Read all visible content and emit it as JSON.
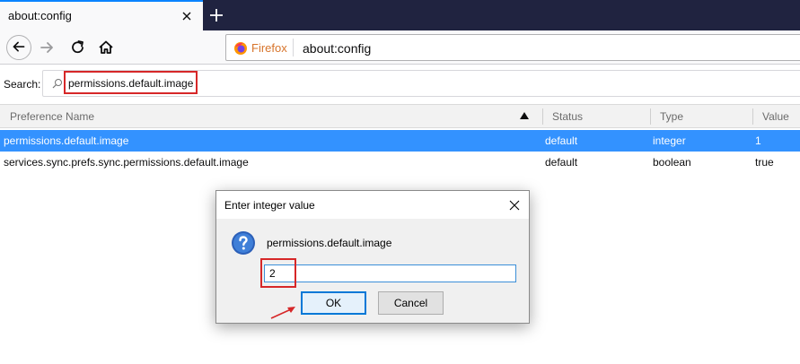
{
  "tab": {
    "title": "about:config"
  },
  "urlbar": {
    "identity_label": "Firefox",
    "url": "about:config"
  },
  "search": {
    "label": "Search:",
    "value": "permissions.default.image"
  },
  "table": {
    "headers": {
      "name": "Preference Name",
      "status": "Status",
      "type": "Type",
      "value": "Value"
    },
    "rows": [
      {
        "name": "permissions.default.image",
        "status": "default",
        "type": "integer",
        "value": "1"
      },
      {
        "name": "services.sync.prefs.sync.permissions.default.image",
        "status": "default",
        "type": "boolean",
        "value": "true"
      }
    ]
  },
  "dialog": {
    "title": "Enter integer value",
    "message": "permissions.default.image",
    "input_value": "2",
    "ok_label": "OK",
    "cancel_label": "Cancel"
  },
  "colors": {
    "tabstrip": "#202340",
    "selected_row": "#3392ff",
    "annotation": "#d62728",
    "firefox_label": "#d7742b"
  },
  "icons": [
    "close-icon",
    "plus-icon",
    "back-icon",
    "forward-icon",
    "reload-icon",
    "home-icon",
    "firefox-logo-icon",
    "search-icon",
    "sort-ascending-icon",
    "question-icon",
    "arrow-annotation-icon"
  ]
}
